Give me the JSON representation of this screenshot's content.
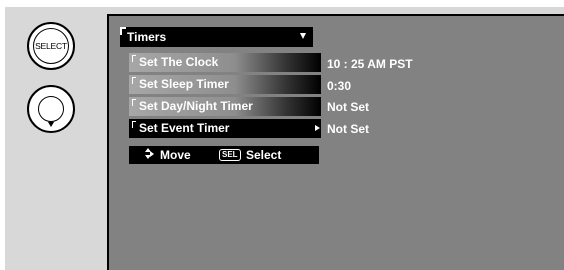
{
  "remote": {
    "select_button_label": "SELECT"
  },
  "menu": {
    "title": "Timers",
    "items": [
      {
        "label": "Set The Clock",
        "value": "10 : 25 AM PST",
        "selected": false
      },
      {
        "label": "Set Sleep Timer",
        "value": "0:30",
        "selected": false
      },
      {
        "label": "Set Day/Night Timer",
        "value": "Not Set",
        "selected": false
      },
      {
        "label": "Set Event Timer",
        "value": "Not Set",
        "selected": true
      }
    ]
  },
  "help": {
    "move_label": "Move",
    "sel_key": "SEL",
    "select_label": "Select"
  },
  "colors": {
    "screen_bg": "#828282",
    "frame_bg": "#d8d8d8",
    "menu_bar": "#000000",
    "text": "#ffffff"
  },
  "icons": {
    "select_button": "select-button-icon",
    "dpad": "dpad-down-icon",
    "title_caret": "caret-down-icon",
    "row_arrow": "arrow-right-icon",
    "move": "up-down-arrow-icon"
  }
}
